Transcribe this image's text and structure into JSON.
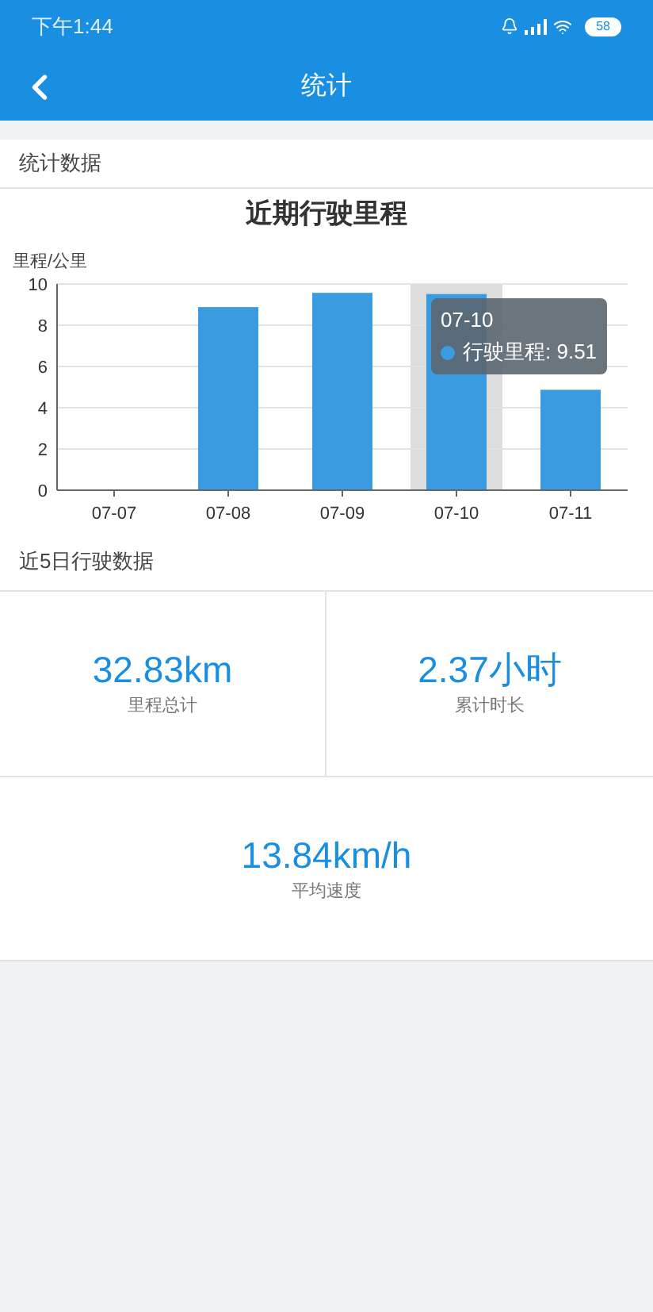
{
  "status_bar": {
    "time": "下午1:44",
    "battery": "58"
  },
  "header": {
    "title": "统计"
  },
  "section_title": "统计数据",
  "chart": {
    "chart_data": {
      "type": "bar",
      "title": "近期行驶里程",
      "ylabel": "里程/公里",
      "categories": [
        "07-07",
        "07-08",
        "07-09",
        "07-10",
        "07-11"
      ],
      "series": [
        {
          "name": "行驶里程",
          "color": "#3a9be0",
          "values": [
            0,
            8.88,
            9.57,
            9.51,
            4.87
          ]
        }
      ],
      "ylim": [
        0,
        10
      ],
      "yticks": [
        0,
        2,
        4,
        6,
        8,
        10
      ],
      "grid": true
    },
    "hover": [
      false,
      false,
      false,
      true,
      false
    ],
    "tooltip": {
      "title": "07-10",
      "separator": ": ",
      "value": "9.51"
    }
  },
  "subsection_title": "近5日行驶数据",
  "stats": [
    {
      "value": "32.83km",
      "label": "里程总计"
    },
    {
      "value": "2.37小时",
      "label": "累计时长"
    },
    {
      "value": "13.84km/h",
      "label": "平均速度"
    }
  ]
}
